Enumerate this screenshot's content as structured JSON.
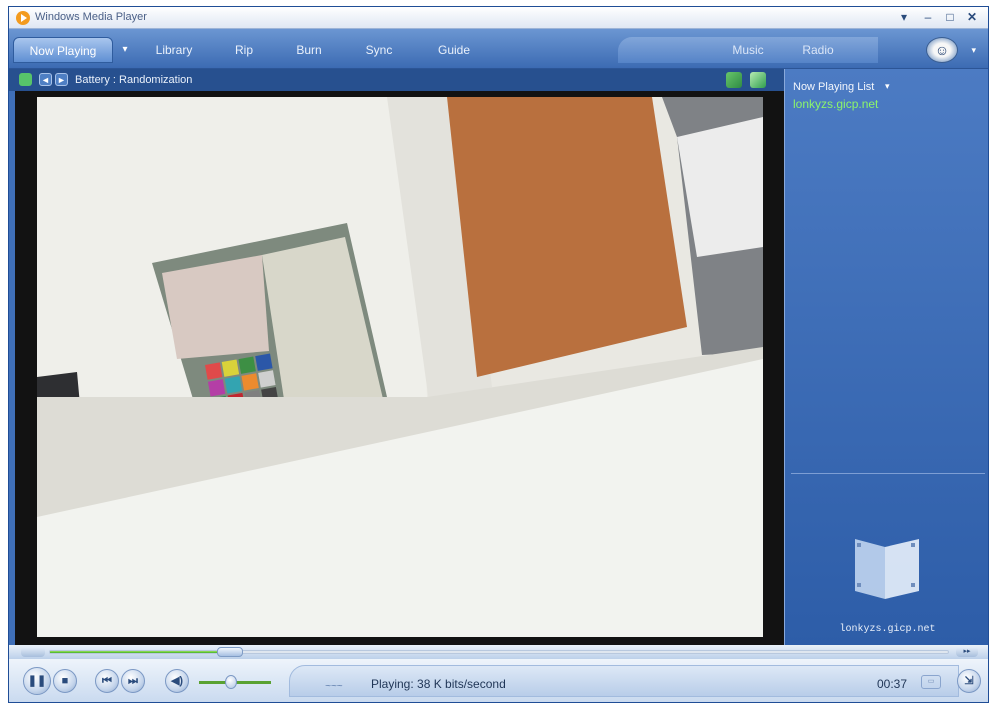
{
  "window": {
    "title": "Windows Media Player",
    "menu_glyph": "▾",
    "min_glyph": "–",
    "max_glyph": "□",
    "close_glyph": "✕"
  },
  "tabs": {
    "now_playing": "Now Playing",
    "now_playing_arrow": "▾",
    "library": "Library",
    "rip": "Rip",
    "burn": "Burn",
    "sync": "Sync",
    "guide": "Guide",
    "music": "Music",
    "radio": "Radio",
    "logo_glyph": "☺",
    "logo_arrow": "▾"
  },
  "info_bar": {
    "title": "Battery : Randomization",
    "prev_glyph": "◄",
    "next_glyph": "►"
  },
  "playlist": {
    "title": "Now Playing List",
    "arrow": "▾",
    "items": [
      "lonkyzs.gicp.net"
    ],
    "caption": "lonkyzs.gicp.net"
  },
  "controls": {
    "pause_glyph": "❚❚",
    "stop_glyph": "■",
    "prev_glyph": "⏮",
    "next_glyph": "⏭",
    "mute_glyph": "◀)",
    "status": "Playing: 38 K bits/second",
    "status_icon_text": "~~~",
    "time": "00:37",
    "seek_right_glyph": "▸▸",
    "toggle_glyph": "▭",
    "mini_glyph": "⇲",
    "seek_progress": 0.2,
    "volume_level": 0.45
  },
  "colors": {
    "accent": "#3f6fb8",
    "playlist_item": "#8cf56b",
    "seek_fill": "#41b02b"
  },
  "icons": {
    "app": "media-player-icon",
    "logo": "napster-logo-icon",
    "art": "video-film-icon"
  }
}
